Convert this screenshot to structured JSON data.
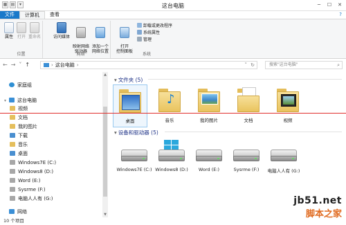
{
  "window": {
    "title": "这台电脑",
    "controls": [
      "─",
      "☐",
      "✕"
    ],
    "qat": [
      "▦",
      "▤",
      "▾"
    ]
  },
  "ribbon_tabs": [
    "文件",
    "计算机",
    "查看"
  ],
  "help_mark": "?",
  "ribbon": {
    "location": {
      "caption": "位置",
      "buttons": [
        "属性",
        "打开",
        "重命名"
      ]
    },
    "network": {
      "caption": "网络",
      "buttons": [
        "访问媒体",
        "映射网络\n驱动器",
        "添加一个\n网络位置"
      ]
    },
    "system": {
      "caption": "系统",
      "open_panel": "打开\n控制面板",
      "items": [
        "卸载或更改程序",
        "系统属性",
        "管理"
      ]
    }
  },
  "address": {
    "path": "这台电脑",
    "sep": "›",
    "search_placeholder": "搜索\"这台电脑\""
  },
  "nav_buttons": [
    "←",
    "→",
    "˅",
    "↑"
  ],
  "nav_pane": {
    "homegroup": "家庭组",
    "this_pc": "这台电脑",
    "items": [
      "视频",
      "文档",
      "我的图片",
      "下载",
      "音乐",
      "桌面",
      "Windows7E (C:)",
      "Windows8 (D:)",
      "Word (E:)",
      "Sysrme (F:)",
      "电脑人人有 (G:)"
    ],
    "network": "网络"
  },
  "folders_section": {
    "header": "文件夹 (5)",
    "items": [
      "桌面",
      "音乐",
      "我的图片",
      "文档",
      "视频"
    ]
  },
  "drives_section": {
    "header": "设备和驱动器 (5)",
    "items": [
      "Windows7E (C:)",
      "Windows8 (D:)",
      "Word (E:)",
      "Sysrme (F:)",
      "电脑人人有 (G:)"
    ]
  },
  "status": {
    "count": "10 个项目"
  },
  "watermark": {
    "site": "jb51.net",
    "name": "脚本之家"
  },
  "colors": {
    "accent": "#1979ca",
    "annotation_line": "#e0302d",
    "watermark_text": "#e06a1f"
  }
}
